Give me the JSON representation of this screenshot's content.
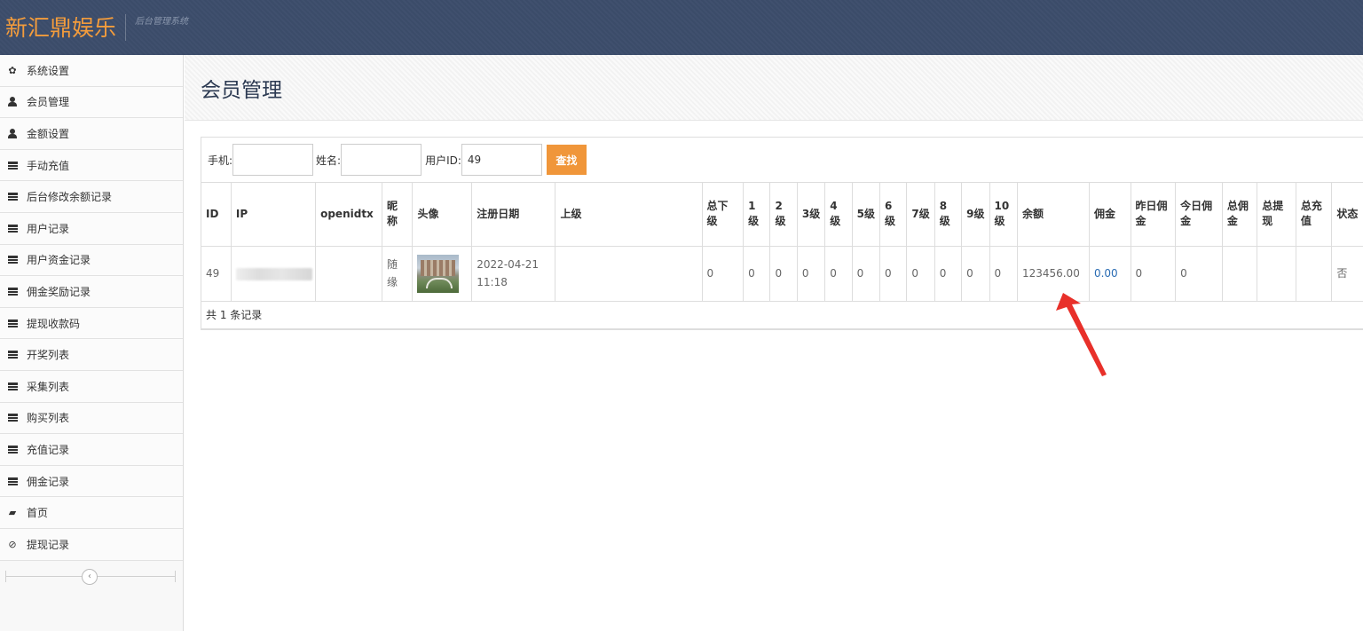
{
  "header": {
    "brand": "新汇鼎娱乐",
    "subtitle": "后台管理系统"
  },
  "sidebar": {
    "items": [
      {
        "label": "系统设置",
        "icon": "gear-icon"
      },
      {
        "label": "会员管理",
        "icon": "user-icon"
      },
      {
        "label": "金额设置",
        "icon": "user-icon"
      },
      {
        "label": "手动充值",
        "icon": "calendar-icon"
      },
      {
        "label": "后台修改余额记录",
        "icon": "calendar-icon"
      },
      {
        "label": "用户记录",
        "icon": "calendar-icon"
      },
      {
        "label": "用户资金记录",
        "icon": "calendar-icon"
      },
      {
        "label": "佣金奖励记录",
        "icon": "calendar-icon"
      },
      {
        "label": "提现收款码",
        "icon": "calendar-icon"
      },
      {
        "label": "开奖列表",
        "icon": "calendar-icon"
      },
      {
        "label": "采集列表",
        "icon": "calendar-icon"
      },
      {
        "label": "购买列表",
        "icon": "calendar-icon"
      },
      {
        "label": "充值记录",
        "icon": "calendar-icon"
      },
      {
        "label": "佣金记录",
        "icon": "calendar-icon"
      },
      {
        "label": "首页",
        "icon": "folder-icon"
      },
      {
        "label": "提现记录",
        "icon": "ban-icon"
      }
    ],
    "collapse_glyph": "‹"
  },
  "page": {
    "title": "会员管理"
  },
  "search": {
    "phone_label": "手机:",
    "phone_value": "",
    "name_label": "姓名:",
    "name_value": "",
    "userid_label": "用户ID:",
    "userid_value": "49",
    "button": "查找"
  },
  "table": {
    "headers": [
      "ID",
      "IP",
      "openidtx",
      "昵称",
      "头像",
      "注册日期",
      "上级",
      "总下级",
      "1级",
      "2级",
      "3级",
      "4级",
      "5级",
      "6级",
      "7级",
      "8级",
      "9级",
      "10级",
      "余额",
      "佣金",
      "昨日佣金",
      "今日佣金",
      "总佣金",
      "总提现",
      "总充值",
      "状态"
    ],
    "rows": [
      {
        "id": "49",
        "ip": "",
        "openidtx": "",
        "nickname": "随缘",
        "avatar": "avatar-image",
        "reg_date": "2022-04-21",
        "reg_time": "11:18",
        "parent": "",
        "total_sub": "0",
        "l1": "0",
        "l2": "0",
        "l3": "0",
        "l4": "0",
        "l5": "0",
        "l6": "0",
        "l7": "0",
        "l8": "0",
        "l9": "0",
        "l10": "0",
        "balance": "123456.00",
        "commission": "0.00",
        "yesterday_commission": "0",
        "today_commission": "0",
        "total_commission": "",
        "total_withdraw": "",
        "total_recharge": "",
        "status": "否"
      }
    ],
    "footer": "共 1 条记录"
  },
  "colors": {
    "navbar": "#3c4d6b",
    "brand": "#f39c3c",
    "search_button": "#f0963a",
    "link": "#2a6cb3",
    "arrow": "#e8302a"
  }
}
